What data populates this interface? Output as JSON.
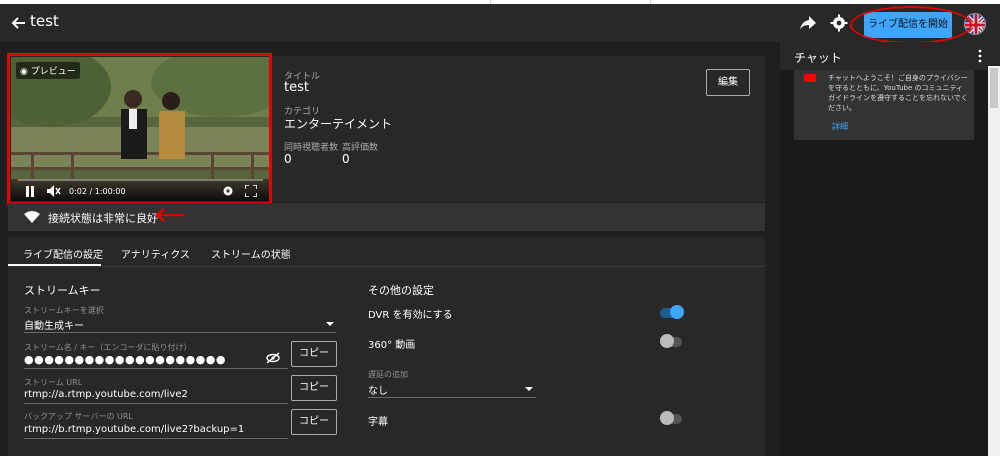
{
  "header": {
    "title": "test",
    "go_live_label": "ライブ配信を開始"
  },
  "preview": {
    "label": "プレビュー",
    "time": "0:02 / 1:00:00",
    "progress_fraction": 0.0003
  },
  "stream_info": {
    "title_label": "タイトル",
    "title_value": "test",
    "category_label": "カテゴリ",
    "category_value": "エンターテイメント",
    "viewers_label": "同時視聴者数",
    "viewers_value": "0",
    "likes_label": "高評価数",
    "likes_value": "0",
    "edit_label": "編集"
  },
  "connection": {
    "status": "接続状態は非常に良好"
  },
  "tabs": [
    {
      "label": "ライブ配信の設定"
    },
    {
      "label": "アナリティクス"
    },
    {
      "label": "ストリームの状態"
    }
  ],
  "stream_key": {
    "section_title": "ストリームキー",
    "select_label": "ストリームキーを選択",
    "select_value": "自動生成キー",
    "name_label": "ストリーム名 / キー（エンコーダに貼り付け）",
    "name_value": "●●●●●●●●●●●●●●●●●●●●",
    "url_label": "ストリーム URL",
    "url_value": "rtmp://a.rtmp.youtube.com/live2",
    "backup_label": "バックアップ サーバーの URL",
    "backup_value": "rtmp://b.rtmp.youtube.com/live2?backup=1",
    "copy_label": "コピー"
  },
  "other_settings": {
    "section_title": "その他の設定",
    "dvr_label": "DVR を有効にする",
    "dvr_on": true,
    "vr_label": "360° 動画",
    "vr_on": false,
    "delay_label": "遅延の追加",
    "delay_value": "なし",
    "captions_label": "字幕",
    "captions_on": false
  },
  "chat": {
    "title": "チャット",
    "welcome": "チャットへようこそ！ご自身のプライバシーを守るとともに、YouTube のコミュニティ ガイドラインを遵守することを忘れないでください。",
    "details_label": "詳細"
  },
  "colors": {
    "accent": "#3ea6ff",
    "annotation_red": "#e10000"
  }
}
